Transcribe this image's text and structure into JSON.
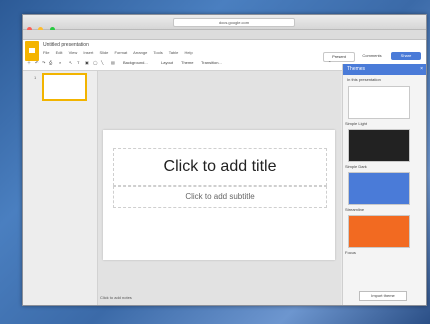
{
  "browser": {
    "address": "docs.google.com"
  },
  "app": {
    "doc_title": "Untitled presentation",
    "menus": [
      "File",
      "Edit",
      "View",
      "Insert",
      "Slide",
      "Format",
      "Arrange",
      "Tools",
      "Table",
      "Help"
    ],
    "present_label": "Present",
    "comments_label": "Comments",
    "share_label": "Share"
  },
  "toolbar": {
    "background_label": "Background...",
    "layout_label": "Layout",
    "theme_label": "Theme",
    "transition_label": "Transition..."
  },
  "filmstrip": {
    "slide_number": "1"
  },
  "slide": {
    "title_placeholder": "Click to add title",
    "subtitle_placeholder": "Click to add subtitle"
  },
  "notes": {
    "placeholder": "Click to add notes"
  },
  "themes_panel": {
    "title": "Themes",
    "close_glyph": "×",
    "subtitle": "In this presentation",
    "items": [
      {
        "name": "Simple Light",
        "bg": "#ffffff",
        "fg": "#333333"
      },
      {
        "name": "Simple Dark",
        "bg": "#222222",
        "fg": "#dddddd"
      },
      {
        "name": "Streamline",
        "bg": "#4a7bd8",
        "fg": "#ffffff"
      },
      {
        "name": "Focus",
        "bg": "#f26a21",
        "fg": "#ffffff"
      }
    ],
    "import_label": "Import theme"
  },
  "colors": {
    "accent_blue": "#4a7bd8",
    "slides_yellow": "#f4b400"
  }
}
